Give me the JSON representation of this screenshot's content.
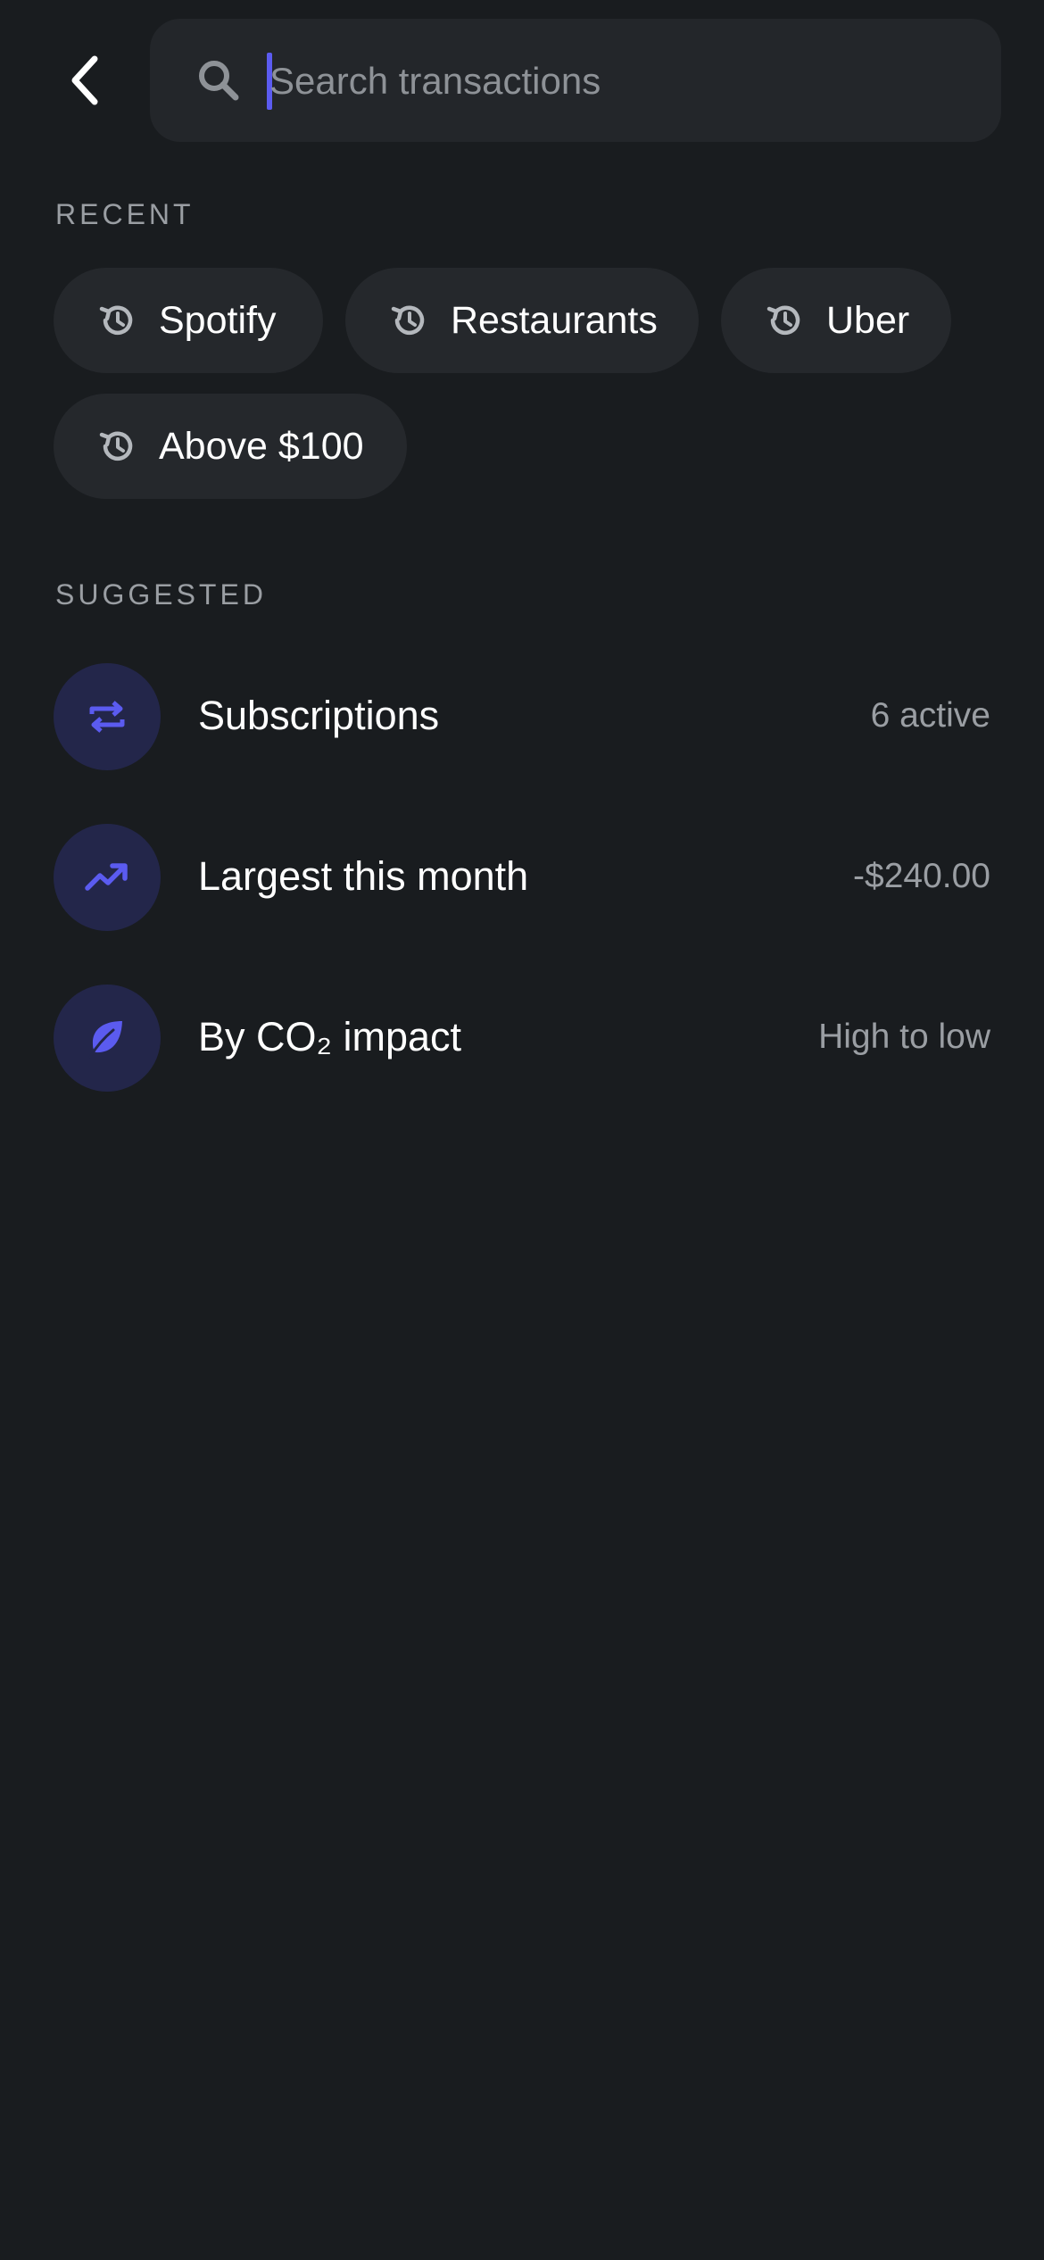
{
  "header": {
    "back_icon": "chevron-left-icon",
    "search": {
      "placeholder": "Search transactions",
      "value": "",
      "icon": "search-icon"
    }
  },
  "recent": {
    "label": "RECENT",
    "chip_icon": "history-icon",
    "items": [
      {
        "label": "Spotify"
      },
      {
        "label": "Restaurants"
      },
      {
        "label": "Uber"
      },
      {
        "label": "Above $100"
      }
    ]
  },
  "suggested": {
    "label": "SUGGESTED",
    "items": [
      {
        "title": "Subscriptions",
        "meta": "6 active",
        "icon": "repeat-icon"
      },
      {
        "title": "Largest this month",
        "meta": "-$240.00",
        "icon": "trending-up-icon"
      },
      {
        "title": "By CO₂ impact",
        "meta": "High to low",
        "icon": "leaf-icon"
      }
    ]
  },
  "colors": {
    "background": "#191c1f",
    "surface": "#23262a",
    "accent": "#5b5bf0",
    "accent_bg": "#23264a",
    "muted_text": "#9a9ea3"
  }
}
